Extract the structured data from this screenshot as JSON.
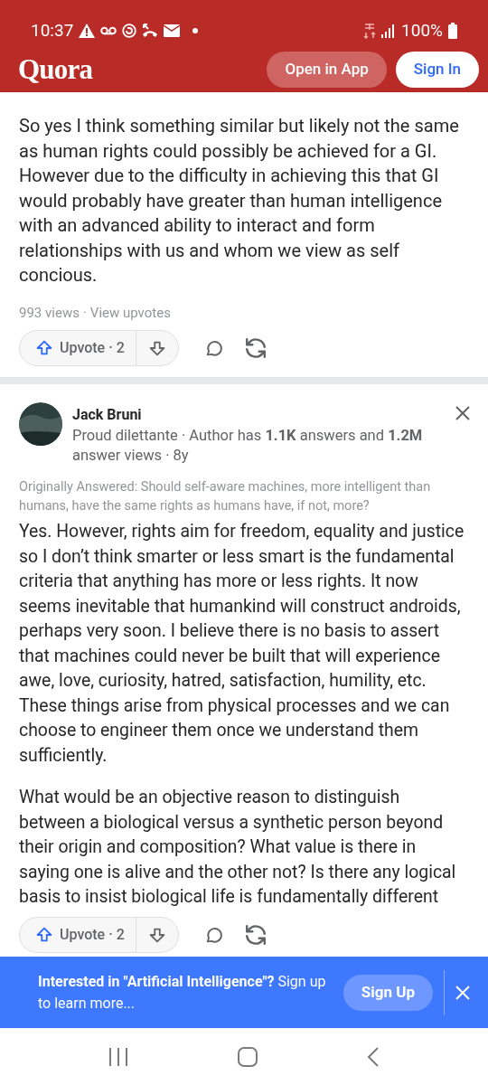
{
  "status_bar": {
    "time": "10:37",
    "battery": "100%"
  },
  "header": {
    "logo": "Quora",
    "open_in_app": "Open in App",
    "sign_in": "Sign In"
  },
  "answers": [
    {
      "body": [
        "So yes I think something similar but likely not the same as human rights could possibly be achieved for a GI. However due to the difficulty in achieving this that GI would probably have greater than human intelligence with an advanced ability to interact and form relationships with us and whom we view as self concious."
      ],
      "views": "993 views",
      "separator": "·",
      "view_upvotes": "View upvotes",
      "upvote": "Upvote · 2"
    },
    {
      "author": {
        "name": "Jack Bruni",
        "credential": "Proud dilettante · Author has **1.1K** answers and **1.2M** answer views · 8y"
      },
      "originally_answered": "Originally Answered: Should self-aware machines, more intelligent than humans, have the same rights as humans have, if not, more?",
      "body": [
        "Yes. However, rights aim for freedom, equality and justice so I don’t think smarter or less smart is the fundamental criteria that anything has more or less rights. It now seems inevitable that humankind will construct androids, perhaps very soon. I believe there is no basis to assert that machines could never be built that will experience awe, love, curiosity, hatred, satisfaction, humility, etc. These things arise from physical processes and we can choose to engineer them once we understand them sufficiently.",
        "What would be an objective reason to distinguish between a biological versus a synthetic person beyond their origin and composition? What value is there in saying one is alive and the other not? Is there any logical basis to insist biological life is fundamentally different"
      ],
      "upvote": "Upvote · 2"
    }
  ],
  "banner": {
    "text": "**Interested in \"Artificial Intelligence\"?** Sign up to learn more...",
    "button": "Sign Up"
  }
}
